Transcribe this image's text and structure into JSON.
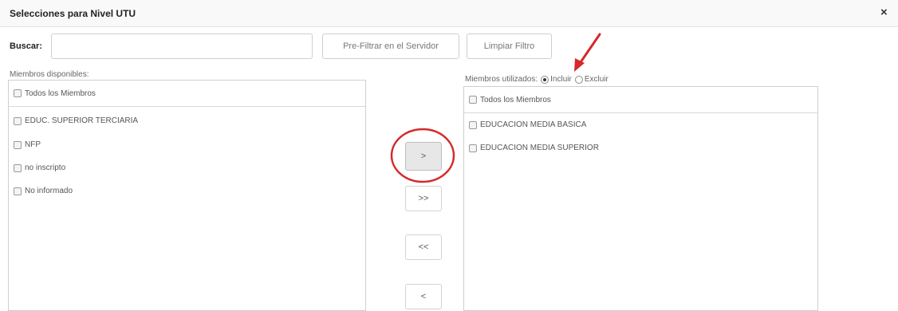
{
  "dialog": {
    "title": "Selecciones para Nivel UTU",
    "close_glyph": "×"
  },
  "search": {
    "label": "Buscar:",
    "value": "",
    "placeholder": "",
    "prefilter_label": "Pre-Filtrar en el Servidor",
    "clear_label": "Limpiar Filtro"
  },
  "available": {
    "label": "Miembros disponibles:",
    "all_label": "Todos los Miembros",
    "items": [
      "EDUC. SUPERIOR TERCIARIA",
      "NFP",
      "no inscripto",
      "No informado"
    ]
  },
  "used": {
    "label": "Miembros utilizados:",
    "include_label": "Incluir",
    "exclude_label": "Excluir",
    "mode": "Incluir",
    "all_label": "Todos los Miembros",
    "items": [
      "EDUCACION MEDIA BASICA",
      "EDUCACION MEDIA SUPERIOR"
    ]
  },
  "move_buttons": {
    "add": ">",
    "add_all": ">>",
    "remove_all": "<<",
    "remove": "<"
  },
  "annotations": {
    "color": "#d42a2a"
  }
}
